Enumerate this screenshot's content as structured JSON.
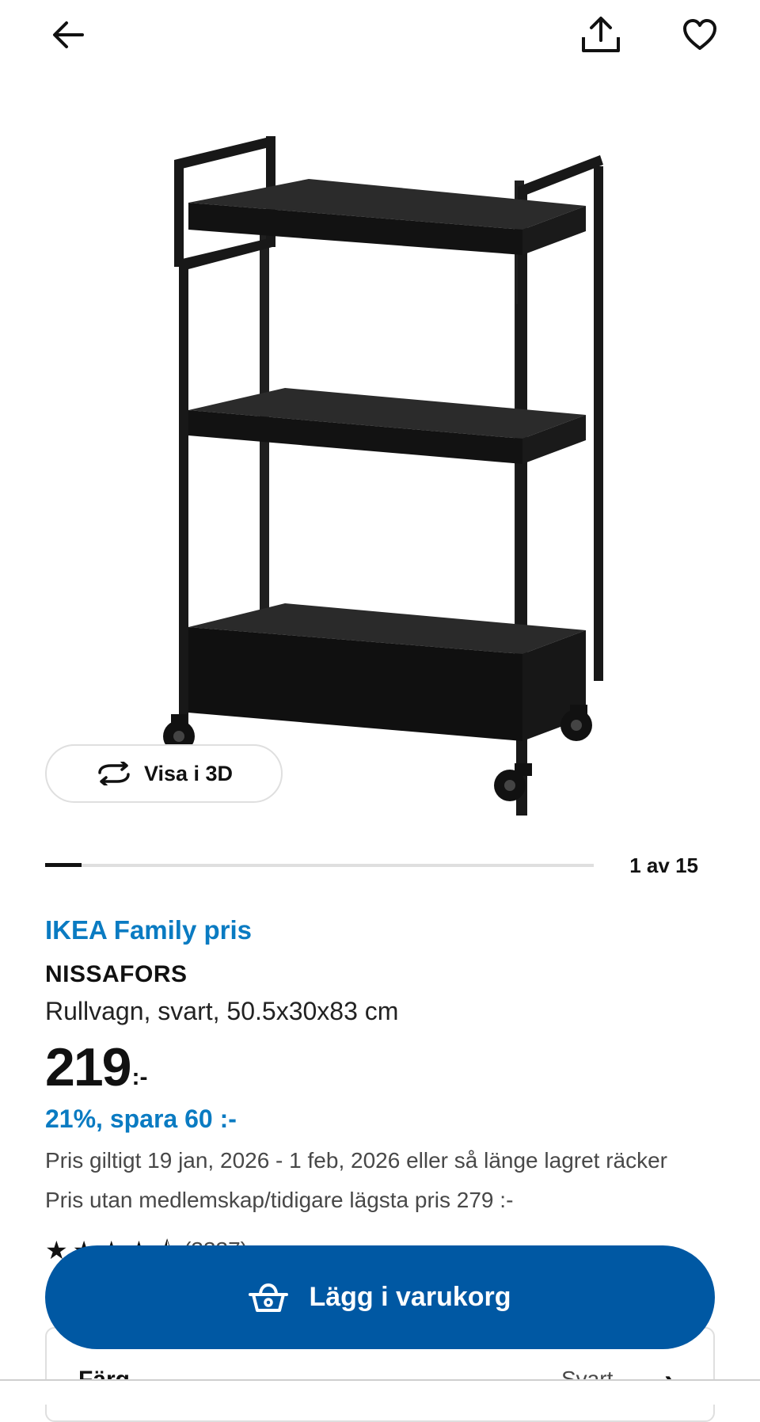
{
  "header": {
    "back_icon": "arrow-left-icon",
    "share_icon": "share-upload-icon",
    "favorite_icon": "heart-outline-icon"
  },
  "gallery": {
    "image_alt": "NISSAFORS Rullvagn, svart",
    "view3d_label": "Visa i 3D",
    "view3d_icon": "rotate-3d-icon",
    "counter_text": "1 av 15",
    "current_index": 1,
    "total_images": 15
  },
  "product": {
    "family_label": "IKEA Family pris",
    "name": "NISSAFORS",
    "description": "Rullvagn, svart, 50.5x30x83 cm",
    "price_main": "219",
    "price_suffix": ":-",
    "discount_text": "21%, spara 60 :-",
    "validity_text": "Pris giltigt 19 jan, 2026 - 1 feb, 2026 eller så länge lagret räcker",
    "previous_price_text": "Pris utan medlemskap/tidigare lägsta pris 279 :-",
    "rating": {
      "stars": 4.5,
      "count_text": "(3337)"
    }
  },
  "color_selector": {
    "label": "Färg",
    "value": "Svart"
  },
  "cart": {
    "button_label": "Lägg i varukorg",
    "icon": "shopping-basket-icon"
  },
  "colors": {
    "primary_blue": "#0058a3",
    "family_blue": "#0a7bc2",
    "text_dark": "#111111",
    "text_muted": "#484848",
    "border": "#dfdfdf"
  }
}
